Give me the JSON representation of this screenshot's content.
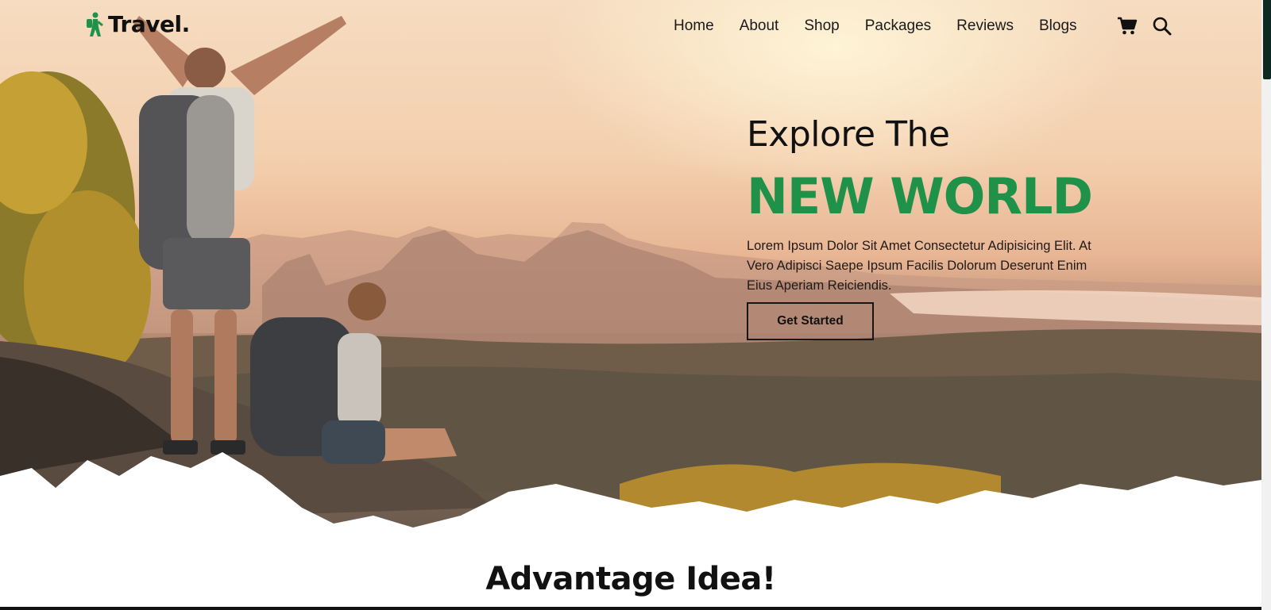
{
  "brand": {
    "name": "Travel.",
    "icon": "hiker-icon",
    "accent": "#1f9149"
  },
  "nav": {
    "items": [
      {
        "label": "Home"
      },
      {
        "label": "About"
      },
      {
        "label": "Shop"
      },
      {
        "label": "Packages"
      },
      {
        "label": "Reviews"
      },
      {
        "label": "Blogs"
      }
    ],
    "icons": [
      "cart-icon",
      "search-icon"
    ]
  },
  "hero": {
    "heading_1": "Explore The",
    "heading_2": "NEW WORLD",
    "description": "Lorem Ipsum Dolor Sit Amet Consectetur Adipisicing Elit. At Vero Adipisci Saepe Ipsum Facilis Dolorum Deserunt Enim Eius Aperiam Reiciendis.",
    "cta_label": "Get Started"
  },
  "section": {
    "title": "Advantage Idea!"
  },
  "colors": {
    "accent_green": "#1f9149",
    "text_dark": "#111111",
    "scroll_thumb": "#0e2a20"
  }
}
